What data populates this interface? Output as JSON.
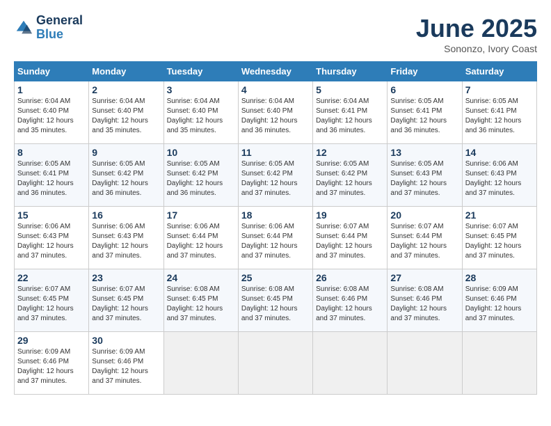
{
  "header": {
    "logo_line1": "General",
    "logo_line2": "Blue",
    "month": "June 2025",
    "location": "Sononzo, Ivory Coast"
  },
  "weekdays": [
    "Sunday",
    "Monday",
    "Tuesday",
    "Wednesday",
    "Thursday",
    "Friday",
    "Saturday"
  ],
  "weeks": [
    [
      {
        "day": "1",
        "sunrise": "6:04 AM",
        "sunset": "6:40 PM",
        "daylight": "12 hours and 35 minutes."
      },
      {
        "day": "2",
        "sunrise": "6:04 AM",
        "sunset": "6:40 PM",
        "daylight": "12 hours and 35 minutes."
      },
      {
        "day": "3",
        "sunrise": "6:04 AM",
        "sunset": "6:40 PM",
        "daylight": "12 hours and 35 minutes."
      },
      {
        "day": "4",
        "sunrise": "6:04 AM",
        "sunset": "6:40 PM",
        "daylight": "12 hours and 36 minutes."
      },
      {
        "day": "5",
        "sunrise": "6:04 AM",
        "sunset": "6:41 PM",
        "daylight": "12 hours and 36 minutes."
      },
      {
        "day": "6",
        "sunrise": "6:05 AM",
        "sunset": "6:41 PM",
        "daylight": "12 hours and 36 minutes."
      },
      {
        "day": "7",
        "sunrise": "6:05 AM",
        "sunset": "6:41 PM",
        "daylight": "12 hours and 36 minutes."
      }
    ],
    [
      {
        "day": "8",
        "sunrise": "6:05 AM",
        "sunset": "6:41 PM",
        "daylight": "12 hours and 36 minutes."
      },
      {
        "day": "9",
        "sunrise": "6:05 AM",
        "sunset": "6:42 PM",
        "daylight": "12 hours and 36 minutes."
      },
      {
        "day": "10",
        "sunrise": "6:05 AM",
        "sunset": "6:42 PM",
        "daylight": "12 hours and 36 minutes."
      },
      {
        "day": "11",
        "sunrise": "6:05 AM",
        "sunset": "6:42 PM",
        "daylight": "12 hours and 37 minutes."
      },
      {
        "day": "12",
        "sunrise": "6:05 AM",
        "sunset": "6:42 PM",
        "daylight": "12 hours and 37 minutes."
      },
      {
        "day": "13",
        "sunrise": "6:05 AM",
        "sunset": "6:43 PM",
        "daylight": "12 hours and 37 minutes."
      },
      {
        "day": "14",
        "sunrise": "6:06 AM",
        "sunset": "6:43 PM",
        "daylight": "12 hours and 37 minutes."
      }
    ],
    [
      {
        "day": "15",
        "sunrise": "6:06 AM",
        "sunset": "6:43 PM",
        "daylight": "12 hours and 37 minutes."
      },
      {
        "day": "16",
        "sunrise": "6:06 AM",
        "sunset": "6:43 PM",
        "daylight": "12 hours and 37 minutes."
      },
      {
        "day": "17",
        "sunrise": "6:06 AM",
        "sunset": "6:44 PM",
        "daylight": "12 hours and 37 minutes."
      },
      {
        "day": "18",
        "sunrise": "6:06 AM",
        "sunset": "6:44 PM",
        "daylight": "12 hours and 37 minutes."
      },
      {
        "day": "19",
        "sunrise": "6:07 AM",
        "sunset": "6:44 PM",
        "daylight": "12 hours and 37 minutes."
      },
      {
        "day": "20",
        "sunrise": "6:07 AM",
        "sunset": "6:44 PM",
        "daylight": "12 hours and 37 minutes."
      },
      {
        "day": "21",
        "sunrise": "6:07 AM",
        "sunset": "6:45 PM",
        "daylight": "12 hours and 37 minutes."
      }
    ],
    [
      {
        "day": "22",
        "sunrise": "6:07 AM",
        "sunset": "6:45 PM",
        "daylight": "12 hours and 37 minutes."
      },
      {
        "day": "23",
        "sunrise": "6:07 AM",
        "sunset": "6:45 PM",
        "daylight": "12 hours and 37 minutes."
      },
      {
        "day": "24",
        "sunrise": "6:08 AM",
        "sunset": "6:45 PM",
        "daylight": "12 hours and 37 minutes."
      },
      {
        "day": "25",
        "sunrise": "6:08 AM",
        "sunset": "6:45 PM",
        "daylight": "12 hours and 37 minutes."
      },
      {
        "day": "26",
        "sunrise": "6:08 AM",
        "sunset": "6:46 PM",
        "daylight": "12 hours and 37 minutes."
      },
      {
        "day": "27",
        "sunrise": "6:08 AM",
        "sunset": "6:46 PM",
        "daylight": "12 hours and 37 minutes."
      },
      {
        "day": "28",
        "sunrise": "6:09 AM",
        "sunset": "6:46 PM",
        "daylight": "12 hours and 37 minutes."
      }
    ],
    [
      {
        "day": "29",
        "sunrise": "6:09 AM",
        "sunset": "6:46 PM",
        "daylight": "12 hours and 37 minutes."
      },
      {
        "day": "30",
        "sunrise": "6:09 AM",
        "sunset": "6:46 PM",
        "daylight": "12 hours and 37 minutes."
      },
      null,
      null,
      null,
      null,
      null
    ]
  ],
  "labels": {
    "sunrise": "Sunrise:",
    "sunset": "Sunset:",
    "daylight": "Daylight:"
  }
}
